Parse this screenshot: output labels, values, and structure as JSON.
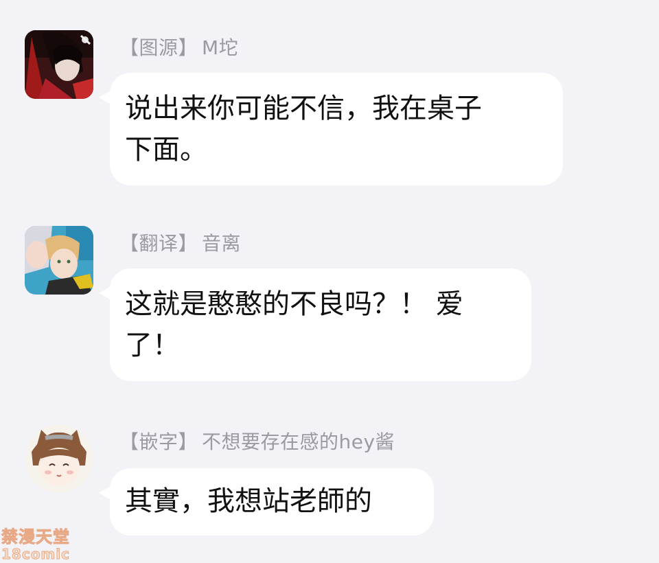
{
  "colors": {
    "background": "#f2f2f7",
    "bubble": "#ffffff",
    "sender_text": "#9a9aa0",
    "message_text": "#111111",
    "watermark": "#e8a27a"
  },
  "messages": [
    {
      "avatar": "dark-red-character-avatar",
      "tag": "【图源】",
      "name": "M坨",
      "lines": [
        "说出来你可能不信，我在桌子",
        "下面。"
      ]
    },
    {
      "avatar": "two-boys-character-avatar",
      "tag": "【翻译】",
      "name": "音离",
      "lines": [
        "这就是憨憨的不良吗？！ 爱",
        "了！"
      ]
    },
    {
      "avatar": "cat-ear-girl-avatar",
      "tag": "【嵌字】",
      "name": "不想要存在感的hey酱",
      "lines": [
        "其實，我想站老師的"
      ]
    }
  ],
  "watermark": {
    "line1": "禁漫天堂",
    "line2": "18comic"
  }
}
